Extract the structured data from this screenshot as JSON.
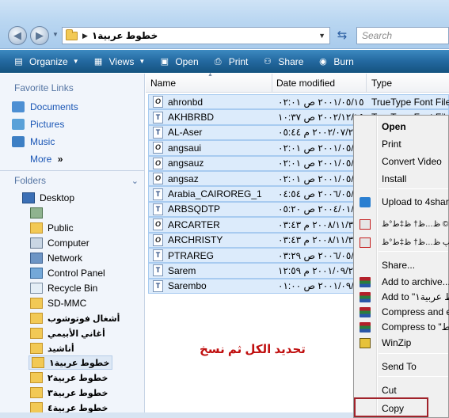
{
  "address": {
    "path": "خطوط عربية١",
    "search_placeholder": "Search"
  },
  "toolbar": [
    {
      "label": "Organize",
      "icon": "organize-icon",
      "dropdown": true
    },
    {
      "label": "Views",
      "icon": "views-icon",
      "dropdown": true
    },
    {
      "label": "Open",
      "icon": "open-icon",
      "dropdown": false
    },
    {
      "label": "Print",
      "icon": "printer-icon",
      "dropdown": false
    },
    {
      "label": "Share",
      "icon": "share-icon",
      "dropdown": false
    },
    {
      "label": "Burn",
      "icon": "burn-icon",
      "dropdown": false
    }
  ],
  "sidebar": {
    "favorites_title": "Favorite Links",
    "favorites": [
      "Documents",
      "Pictures",
      "Music"
    ],
    "more_label": "More",
    "more_chevron": "»",
    "folders_title": "Folders",
    "tree": [
      "Desktop",
      "",
      "Public",
      "Computer",
      "Network",
      "Control Panel",
      "Recycle Bin",
      "SD-MMC",
      "أشغال فوتوشوب",
      "أغاني الأبيمي",
      "أناشيد",
      "خطوط عربية١",
      "خطوط عربية٢",
      "خطوط عربية٣",
      "خطوط عربية٤"
    ]
  },
  "columns": {
    "name": "Name",
    "date": "Date modified",
    "type": "Type"
  },
  "files": [
    {
      "name": "ahronbd",
      "date": "٢٠٠١/٠٥/١٥ ص ٠٢:٠١",
      "type": "TrueType Font File",
      "icon": "O"
    },
    {
      "name": "AKHBRBD",
      "date": "٢٠٠٢/١٢/١٥ ص ١٠:٣٧",
      "type": "TrueType Font File",
      "icon": "T"
    },
    {
      "name": "AL-Aser",
      "date": "٢٠٠٢/٠٧/٢٥ م ٠٥:٤٤",
      "type": "",
      "icon": "T"
    },
    {
      "name": "angsaui",
      "date": "٢٠٠١/٠٥/١٥ ص ٠٢:٠١",
      "type": "",
      "icon": "O"
    },
    {
      "name": "angsauz",
      "date": "٢٠٠١/٠٥/١٥ ص ٠٢:٠١",
      "type": "",
      "icon": "O"
    },
    {
      "name": "angsaz",
      "date": "٢٠٠١/٠٥/١٥ ص ٠٢:٠١",
      "type": "",
      "icon": "O"
    },
    {
      "name": "Arabia_CAIROREG_1",
      "date": "٢٠٠٦/٠٥/١٦ ص ٠٤:٥٤",
      "type": "",
      "icon": "T"
    },
    {
      "name": "ARBSQDTP",
      "date": "٢٠٠٤/٠١/٢٤ ص ٠٥:٢٠",
      "type": "",
      "icon": "T"
    },
    {
      "name": "ARCARTER",
      "date": "٢٠٠٨/١١/٣٠ م ٠٣:٤٣",
      "type": "",
      "icon": "O"
    },
    {
      "name": "ARCHRISTY",
      "date": "٢٠٠٨/١١/٣٠ م ٠٣:٤٣",
      "type": "",
      "icon": "O"
    },
    {
      "name": "PTRAREG",
      "date": "٢٠٠٦/٠٥/١٦ ص ٠٣:٢٩",
      "type": "",
      "icon": "T"
    },
    {
      "name": "Sarem",
      "date": "٢٠٠١/٠٩/٢٠ م ١٢:٥٩",
      "type": "",
      "icon": "T"
    },
    {
      "name": "Sarembo",
      "date": "٢٠٠١/٠٩/٢٠ ص ٠١:٠٠",
      "type": "",
      "icon": "T"
    }
  ],
  "caption": "تحديد الكل ثم نسخ",
  "context_menu": [
    {
      "label": "Open",
      "bold": true,
      "icon": ""
    },
    {
      "label": "Print",
      "icon": ""
    },
    {
      "label": "Convert Video",
      "icon": ""
    },
    {
      "label": "Install",
      "icon": ""
    },
    {
      "label": "Upload to 4shared",
      "icon": "upload-4shared-icon"
    },
    {
      "label": "ظ„ط·ظ„ط¨ ظ†ط³ط®ط© ظ…ظ† ظ‡ط°ظ‡",
      "icon": "pdf-icon"
    },
    {
      "label": "ط¥ظ†ط´ط§ط،% ظ…ظ„ظپ ظ…ظ† ظ‡ط°ظ‡",
      "icon": "pdf-icon"
    },
    {
      "label": "Share...",
      "icon": ""
    },
    {
      "label": "Add to archive...",
      "icon": "winrar-icon"
    },
    {
      "label": "Add to \"خطوط عربية١\"",
      "icon": "winrar-icon"
    },
    {
      "label": "Compress and email...",
      "icon": "winrar-icon"
    },
    {
      "label": "Compress to \"خطوط\"",
      "icon": "winrar-icon"
    },
    {
      "label": "WinZip",
      "icon": "winzip-icon"
    },
    {
      "label": "Send To",
      "icon": ""
    },
    {
      "label": "Cut",
      "icon": ""
    },
    {
      "label": "Copy",
      "icon": ""
    }
  ]
}
